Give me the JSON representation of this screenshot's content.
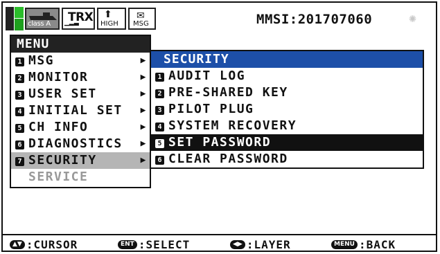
{
  "status_bar": {
    "class_label": "class A",
    "trx_label": "TRX",
    "high_label": "HIGH",
    "msg_label": "MSG",
    "mmsi": "MMSI:201707060"
  },
  "menu": {
    "title": "MENU",
    "items": [
      {
        "num": "1",
        "label": "MSG"
      },
      {
        "num": "2",
        "label": "MONITOR"
      },
      {
        "num": "3",
        "label": "USER SET"
      },
      {
        "num": "4",
        "label": "INITIAL SET"
      },
      {
        "num": "5",
        "label": "CH INFO"
      },
      {
        "num": "6",
        "label": "DIAGNOSTICS"
      },
      {
        "num": "7",
        "label": "SECURITY"
      }
    ],
    "disabled_item": "SERVICE",
    "selected": "SECURITY"
  },
  "submenu": {
    "title": "SECURITY",
    "items": [
      {
        "num": "1",
        "label": "AUDIT LOG"
      },
      {
        "num": "2",
        "label": "PRE-SHARED KEY"
      },
      {
        "num": "3",
        "label": "PILOT PLUG"
      },
      {
        "num": "4",
        "label": "SYSTEM RECOVERY"
      },
      {
        "num": "5",
        "label": "SET PASSWORD"
      },
      {
        "num": "6",
        "label": "CLEAR PASSWORD"
      }
    ],
    "selected": "SET PASSWORD"
  },
  "hints": {
    "cursor_key": "▲▼",
    "cursor_label": ":CURSOR",
    "select_key": "ENT",
    "select_label": ":SELECT",
    "layer_key": "◀▶",
    "layer_label": ":LAYER",
    "back_key": "MENU",
    "back_label": ":BACK"
  },
  "colors": {
    "submenu_title_bg": "#1d4fa8",
    "selected_bg": "#111111",
    "menu_selected_bg": "#b5b5b5",
    "signal_green": "#2bbd2b"
  }
}
